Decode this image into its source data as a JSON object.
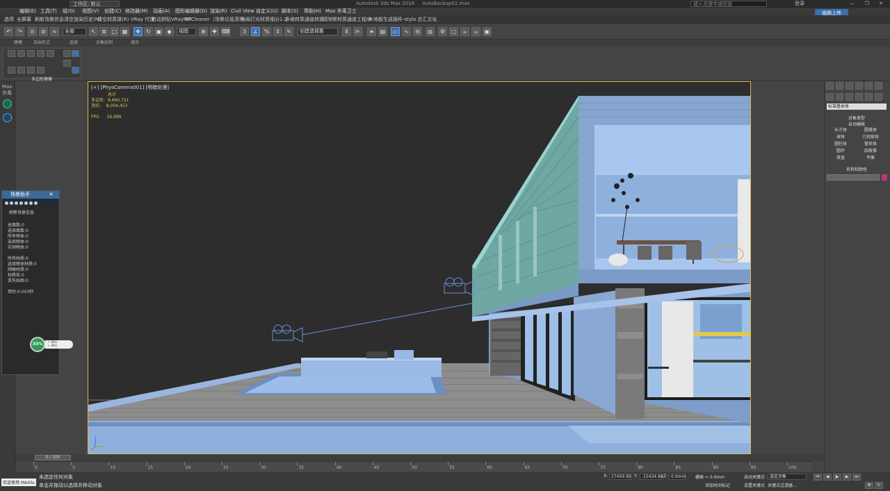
{
  "titlebar": {
    "workspace": "工作区: 默认",
    "title": "Autodesk 3ds Max 2016",
    "file": "AutoBackup01.max",
    "search_placeholder": "键入关键字或短语",
    "login": "登录",
    "window_controls": "— ❐ ✕"
  },
  "menubar": {
    "items": [
      "编辑(E)",
      "工具(T)",
      "组(G)",
      "视图(V)",
      "创建(C)",
      "修改器(M)",
      "动画(A)",
      "图形编辑器(D)",
      "渲染(R)",
      "Civil View",
      "自定义(U)",
      "脚本(S)",
      "帮助(H)",
      "Max 杀毒卫士"
    ],
    "upload_button": "视频上传"
  },
  "pluginbar": {
    "items": [
      "选项",
      "全屏幕",
      "刷新场景信息",
      "清空渲染历史(M)",
      "清空材质球(R)",
      "VRay 代理",
      "启动拼贴VRayMtl",
      "SPCleaner（场景垃圾清理）",
      "全局灯光材质细分1.2",
      "多维材质通道转换",
      "清除断材质通道工程序",
      "木地板生成插件-stylo 总汇文化"
    ]
  },
  "toolbar": {
    "selection_filter": "全部",
    "view_dropdown": "视图",
    "named_selection": "创建选择集"
  },
  "ribbon": {
    "tabs": [
      "建模",
      "自由形式",
      "选择",
      "对象绘制",
      "填充"
    ],
    "group_label": "多边形建模"
  },
  "left_strip": {
    "label1": "Max",
    "label2": "杀毒"
  },
  "viewport": {
    "label": "[+] [PhysCamera001] [明暗处理]",
    "stats": {
      "header": "总计",
      "poly_label": "多边形:",
      "poly_value": "8,690,721",
      "vert_label": "顶点:",
      "vert_value": "8,054,453",
      "fps_label": "FPS:",
      "fps_value": "16.999"
    }
  },
  "scene_info_panel": {
    "title": "场景助手",
    "close": "×",
    "heading": "刷新场景信息",
    "lines": [
      "总面数:0",
      "选择面数:0",
      "所有物体:0",
      "选择物体:0",
      "实例物体:0",
      "",
      "所有材质:0",
      "选择物体材质:0",
      "网格材质:0",
      "材质库:0",
      "丢失贴图:0",
      "",
      "用时:0.003秒"
    ],
    "perf_percent": "33%",
    "perf_up": "0K/s",
    "perf_down": "0K/s"
  },
  "command_panel": {
    "dropdown": "标准基本体",
    "object_type": "对象类型",
    "autogrid": "自动栅格",
    "buttons": [
      "长方体",
      "圆锥体",
      "球体",
      "几何球体",
      "圆柱体",
      "管状体",
      "圆环",
      "四棱锥",
      "茶壶",
      "平面"
    ],
    "name_color": "名称和颜色",
    "color": "#c0307a"
  },
  "timeline": {
    "frame_slider": "0 / 100",
    "ticks": [
      "0",
      "5",
      "10",
      "15",
      "20",
      "25",
      "30",
      "35",
      "40",
      "45",
      "50",
      "55",
      "60",
      "65",
      "70",
      "75",
      "80",
      "85",
      "90",
      "95",
      "100"
    ]
  },
  "status": {
    "maxscript": "欢迎使用 MAXSc",
    "line1": "未选定任何对象",
    "line2": "单击并拖动以选择并移动对象",
    "x_label": "X:",
    "x_value": "27459.90",
    "y_label": "Y:",
    "y_value": "-15434.88",
    "z_label": "Z:",
    "z_value": "0.0mm",
    "grid": "栅格 = 0.0mm",
    "add_time_tag": "添加时间标记",
    "auto_key": "自动关键点",
    "set_key": "设置关键点",
    "selected": "选定对象",
    "key_filters": "关键点过滤器..."
  }
}
